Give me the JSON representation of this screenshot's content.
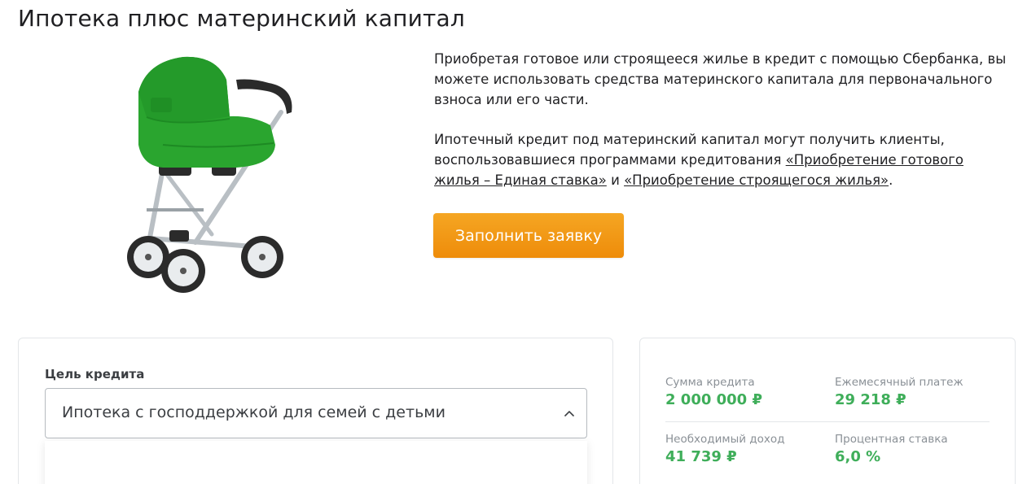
{
  "page": {
    "title": "Ипотека плюс материнский капитал"
  },
  "intro": {
    "paragraph1": "Приобретая готовое или строящееся жилье в кредит с помощью Сбербанка, вы можете использовать средства материнского капитала для первоначального взноса или его части.",
    "paragraph2_start": "Ипотечный кредит под материнский капитал могут получить клиенты, воспользовавшиеся программами кредитования ",
    "link1": "«Приобретение готового жилья – Единая ставка»",
    "paragraph2_middle": " и ",
    "link2": "«Приобретение строящегося жилья»",
    "paragraph2_end": "."
  },
  "apply_button": {
    "label": "Заполнить заявку"
  },
  "form": {
    "purpose_label": "Цель кредита",
    "purpose_value": "Ипотека с господдержкой для семей с детьми"
  },
  "results": {
    "loan_amount_label": "Сумма кредита",
    "loan_amount_value": "2 000 000 ₽",
    "monthly_payment_label": "Ежемесячный платеж",
    "monthly_payment_value": "29 218 ₽",
    "required_income_label": "Необходимый доход",
    "required_income_value": "41 739 ₽",
    "interest_rate_label": "Процентная ставка",
    "interest_rate_value": "6,0 %"
  },
  "colors": {
    "accent_green": "#3fae5a",
    "button_orange": "#f29b18",
    "stroller_green": "#2aa52f"
  },
  "icons": {
    "select_toggle": "chevron-up-icon",
    "hero": "baby-stroller-image"
  }
}
